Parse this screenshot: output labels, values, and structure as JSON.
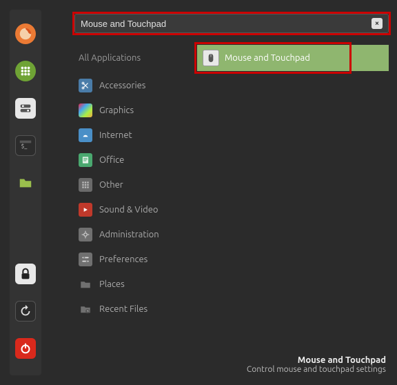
{
  "search": {
    "value": "Mouse and Touchpad"
  },
  "panel": {
    "items": [
      "firefox",
      "apps",
      "settings",
      "terminal",
      "files"
    ],
    "bottom": [
      "lock",
      "reload",
      "power"
    ]
  },
  "categories_header": "All Applications",
  "categories": [
    {
      "icon": "scissors",
      "label": "Accessories"
    },
    {
      "icon": "graphics",
      "label": "Graphics"
    },
    {
      "icon": "internet",
      "label": "Internet"
    },
    {
      "icon": "office",
      "label": "Office"
    },
    {
      "icon": "other",
      "label": "Other"
    },
    {
      "icon": "sound",
      "label": "Sound & Video"
    },
    {
      "icon": "admin",
      "label": "Administration"
    },
    {
      "icon": "prefs",
      "label": "Preferences"
    },
    {
      "icon": "places",
      "label": "Places"
    },
    {
      "icon": "recent",
      "label": "Recent Files"
    }
  ],
  "result": {
    "label": "Mouse and Touchpad"
  },
  "tooltip": {
    "title": "Mouse and Touchpad",
    "desc": "Control mouse and touchpad settings"
  }
}
